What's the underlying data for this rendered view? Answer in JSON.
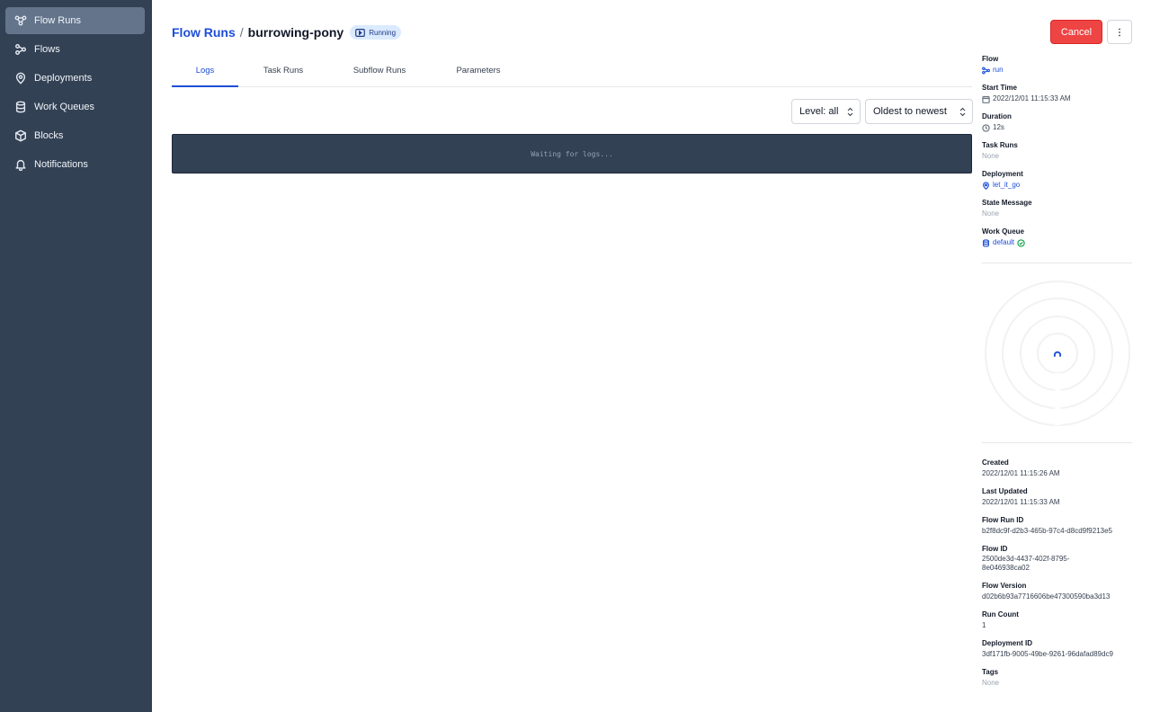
{
  "sidebar": {
    "items": [
      {
        "label": "Flow Runs",
        "icon": "flow-runs-icon",
        "active": true
      },
      {
        "label": "Flows",
        "icon": "flows-icon",
        "active": false
      },
      {
        "label": "Deployments",
        "icon": "map-pin-icon",
        "active": false
      },
      {
        "label": "Work Queues",
        "icon": "database-icon",
        "active": false
      },
      {
        "label": "Blocks",
        "icon": "cube-icon",
        "active": false
      },
      {
        "label": "Notifications",
        "icon": "bell-icon",
        "active": false
      }
    ]
  },
  "header": {
    "breadcrumb_root": "Flow Runs",
    "separator": "/",
    "run_name": "burrowing-pony",
    "state": "Running",
    "cancel_label": "Cancel",
    "menu_icon": "kebab-menu-icon"
  },
  "tabs": [
    {
      "label": "Logs",
      "active": true
    },
    {
      "label": "Task Runs",
      "active": false
    },
    {
      "label": "Subflow Runs",
      "active": false
    },
    {
      "label": "Parameters",
      "active": false
    }
  ],
  "logs": {
    "level_select": "Level: all",
    "order_select": "Oldest to newest",
    "empty_message": "Waiting for logs..."
  },
  "details": {
    "flow_label": "Flow",
    "flow_value": "run",
    "start_time_label": "Start Time",
    "start_time_value": "2022/12/01 11:15:33 AM",
    "duration_label": "Duration",
    "duration_value": "12s",
    "task_runs_label": "Task Runs",
    "task_runs_value": "None",
    "deployment_label": "Deployment",
    "deployment_value": "let_it_go",
    "state_message_label": "State Message",
    "state_message_value": "None",
    "work_queue_label": "Work Queue",
    "work_queue_value": "default"
  },
  "meta": {
    "created_label": "Created",
    "created_value": "2022/12/01 11:15:26 AM",
    "last_updated_label": "Last Updated",
    "last_updated_value": "2022/12/01 11:15:33 AM",
    "flow_run_id_label": "Flow Run ID",
    "flow_run_id_value": "b2f8dc9f-d2b3-465b-97c4-d8cd9f9213e5",
    "flow_id_label": "Flow ID",
    "flow_id_value": "2500de3d-4437-402f-8795-8e046938ca02",
    "flow_version_label": "Flow Version",
    "flow_version_value": "d02b6b93a7716606be47300590ba3d13",
    "run_count_label": "Run Count",
    "run_count_value": "1",
    "deployment_id_label": "Deployment ID",
    "deployment_id_value": "3df171fb-9005-49be-9261-96dafad89dc9",
    "tags_label": "Tags",
    "tags_value": "None"
  },
  "colors": {
    "sidebar_bg": "#334155",
    "accent": "#1d4ed8",
    "cancel": "#ef4444",
    "running_badge": "#dbeafe",
    "healthy": "#16a34a"
  }
}
